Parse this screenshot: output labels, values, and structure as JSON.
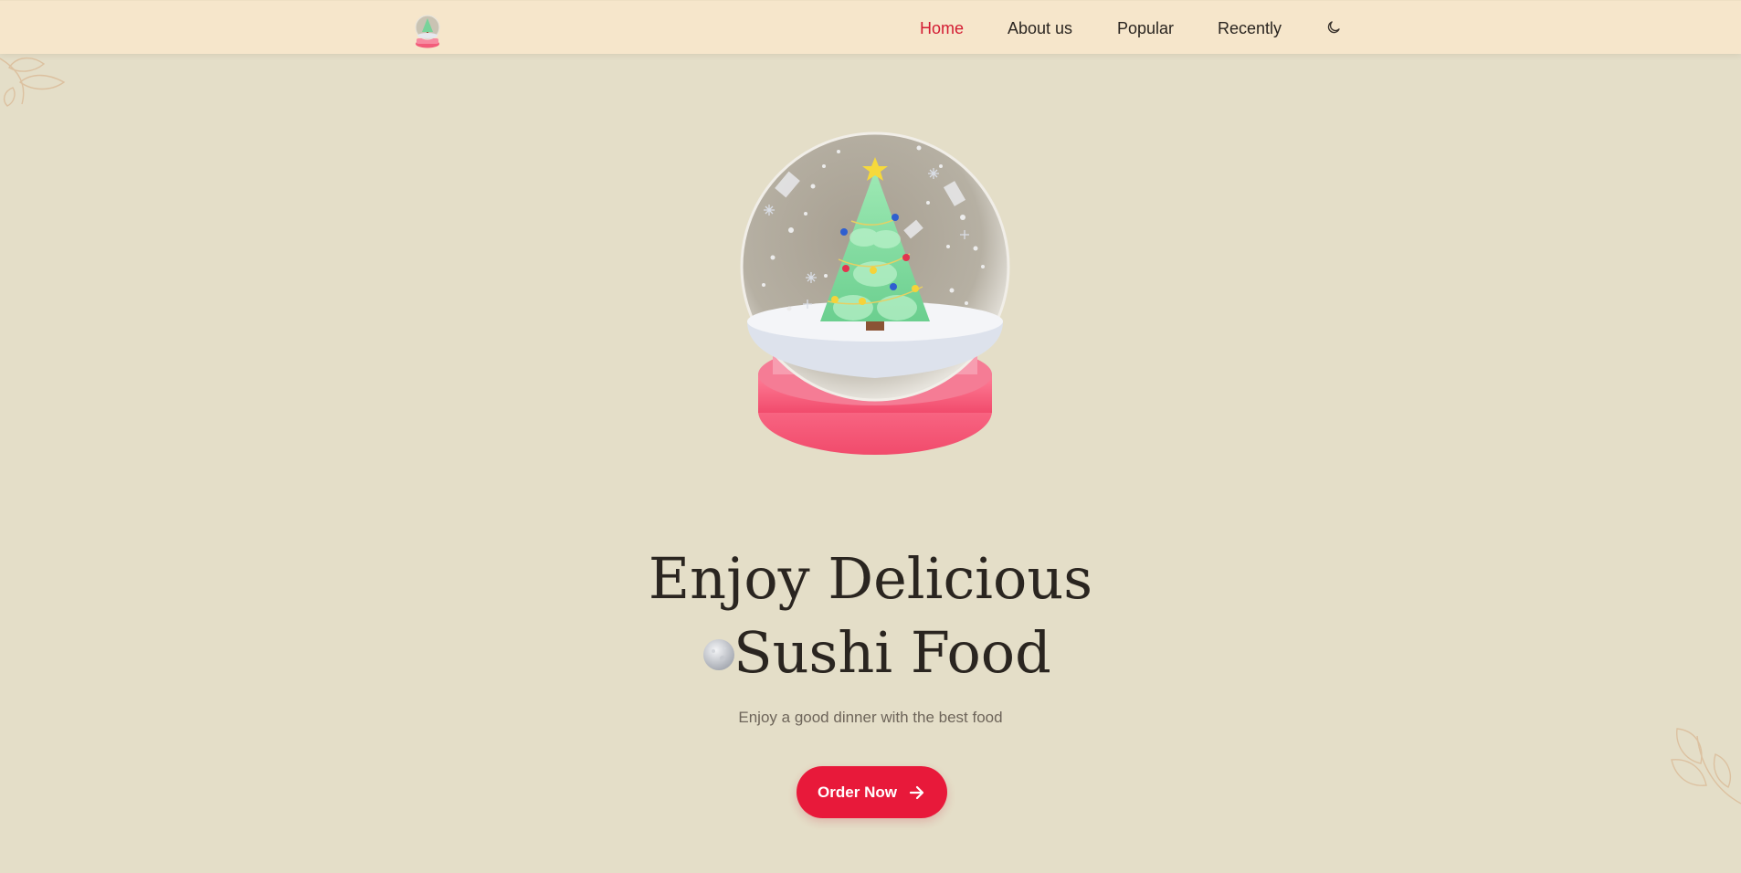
{
  "header": {
    "logo_icon": "snow-globe-logo-icon",
    "nav": [
      {
        "label": "Home",
        "active": true
      },
      {
        "label": "About us",
        "active": false
      },
      {
        "label": "Popular",
        "active": false
      },
      {
        "label": "Recently",
        "active": false
      }
    ],
    "theme_toggle_icon": "moon-icon"
  },
  "hero": {
    "image": "christmas-snow-globe-icon",
    "title_line1": "Enjoy Delicious",
    "title_line2": "Sushi Food",
    "decoration_icon": "snowball-icon",
    "subtitle": "Enjoy a good dinner with the best food",
    "cta_label": "Order Now",
    "cta_icon": "arrow-right-icon"
  },
  "colors": {
    "background": "#e4dec8",
    "header_bg": "#f6e6cb",
    "accent": "#e8193a",
    "active_nav": "#d31b32",
    "text": "#2a2520"
  }
}
